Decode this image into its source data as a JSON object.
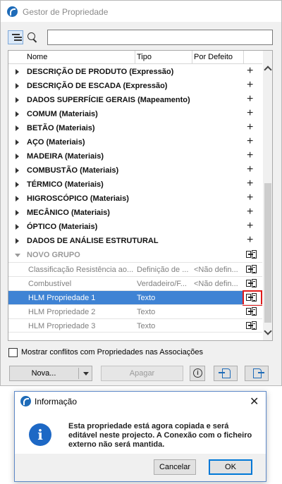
{
  "window": {
    "title": "Gestor de Propriedade"
  },
  "search": {
    "value": "",
    "placeholder": ""
  },
  "columns": {
    "name": "Nome",
    "type": "Tipo",
    "default": "Por Defeito"
  },
  "groups": [
    {
      "label": "DESCRIÇÃO DE PRODUTO (Expressão)"
    },
    {
      "label": "DESCRIÇÃO DE ESCADA (Expressão)"
    },
    {
      "label": "DADOS SUPERFÍCIE GERAIS (Mapeamento)"
    },
    {
      "label": "COMUM (Materiais)"
    },
    {
      "label": "BETÃO (Materiais)"
    },
    {
      "label": "AÇO (Materiais)"
    },
    {
      "label": "MADEIRA (Materiais)"
    },
    {
      "label": "COMBUSTÃO (Materiais)"
    },
    {
      "label": "TÉRMICO (Materiais)"
    },
    {
      "label": "HIGROSCÓPICO (Materiais)"
    },
    {
      "label": "MECÂNICO (Materiais)"
    },
    {
      "label": "ÓPTICO (Materiais)"
    },
    {
      "label": "DADOS DE ANÁLISE ESTRUTURAL"
    }
  ],
  "new_group": {
    "label": "NOVO GRUPO"
  },
  "properties": [
    {
      "name": "Classificação Resistência ao...",
      "type": "Definição de ...",
      "default": "<Não defin..."
    },
    {
      "name": "Combustível",
      "type": "Verdadeiro/F...",
      "default": "<Não defin..."
    },
    {
      "name": "HLM Propriedade 1",
      "type": "Texto",
      "default": ""
    },
    {
      "name": "HLM Propriedade 2",
      "type": "Texto",
      "default": ""
    },
    {
      "name": "HLM Propriedade 3",
      "type": "Texto",
      "default": ""
    }
  ],
  "selected_property": "HLM Propriedade 1",
  "footer": {
    "conflicts_label": "Mostrar conflitos com Propriedades nas Associações",
    "conflicts_checked": false,
    "new_label": "Nova...",
    "delete_label": "Apagar",
    "info_glyph": "i"
  },
  "dialog": {
    "title": "Informação",
    "message": "Esta propriedade está agora copiada e será editável neste projecto. A Conexão com o ficheiro externo não será mantida.",
    "cancel_label": "Cancelar",
    "ok_label": "OK",
    "icon_glyph": "i",
    "close_glyph": "✕"
  },
  "colors": {
    "selection": "#3f83d4",
    "highlight": "#e01b1b",
    "accent": "#1e6bb8"
  }
}
